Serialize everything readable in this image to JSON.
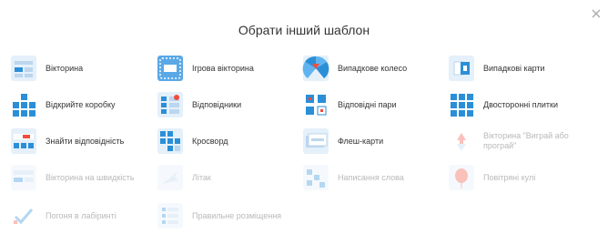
{
  "dialog": {
    "title": "Обрати інший шаблон",
    "close_glyph": "×"
  },
  "templates": [
    {
      "label": "Вікторина",
      "icon": "quiz-icon",
      "enabled": true
    },
    {
      "label": "Ігрова вікторина",
      "icon": "gameshow-quiz-icon",
      "enabled": true
    },
    {
      "label": "Випадкове колесо",
      "icon": "random-wheel-icon",
      "enabled": true
    },
    {
      "label": "Випадкові карти",
      "icon": "random-cards-icon",
      "enabled": true
    },
    {
      "label": "Відкрийте коробку",
      "icon": "open-box-icon",
      "enabled": true
    },
    {
      "label": "Відповідники",
      "icon": "match-up-icon",
      "enabled": true
    },
    {
      "label": "Відповідні пари",
      "icon": "matching-pairs-icon",
      "enabled": true
    },
    {
      "label": "Двосторонні плитки",
      "icon": "flip-tiles-icon",
      "enabled": true
    },
    {
      "label": "Знайти відповідність",
      "icon": "find-match-icon",
      "enabled": true
    },
    {
      "label": "Кросворд",
      "icon": "crossword-icon",
      "enabled": true
    },
    {
      "label": "Флеш-карти",
      "icon": "flash-cards-icon",
      "enabled": true
    },
    {
      "label": "Вікторина \"Виграй або програй\"",
      "icon": "win-or-lose-quiz-icon",
      "enabled": false
    },
    {
      "label": "Вікторина на швидкість",
      "icon": "speed-quiz-icon",
      "enabled": false
    },
    {
      "label": "Літак",
      "icon": "airplane-icon",
      "enabled": false
    },
    {
      "label": "Написання слова",
      "icon": "spell-word-icon",
      "enabled": false
    },
    {
      "label": "Повітряні кулі",
      "icon": "balloon-pop-icon",
      "enabled": false
    },
    {
      "label": "Погоня в лабіринті",
      "icon": "maze-chase-icon",
      "enabled": false
    },
    {
      "label": "Правильне розміщення",
      "icon": "rank-order-icon",
      "enabled": false
    }
  ],
  "colors": {
    "icon_blue": "#2b8fd8",
    "icon_bg": "#e4f0fa",
    "text": "#333333"
  }
}
